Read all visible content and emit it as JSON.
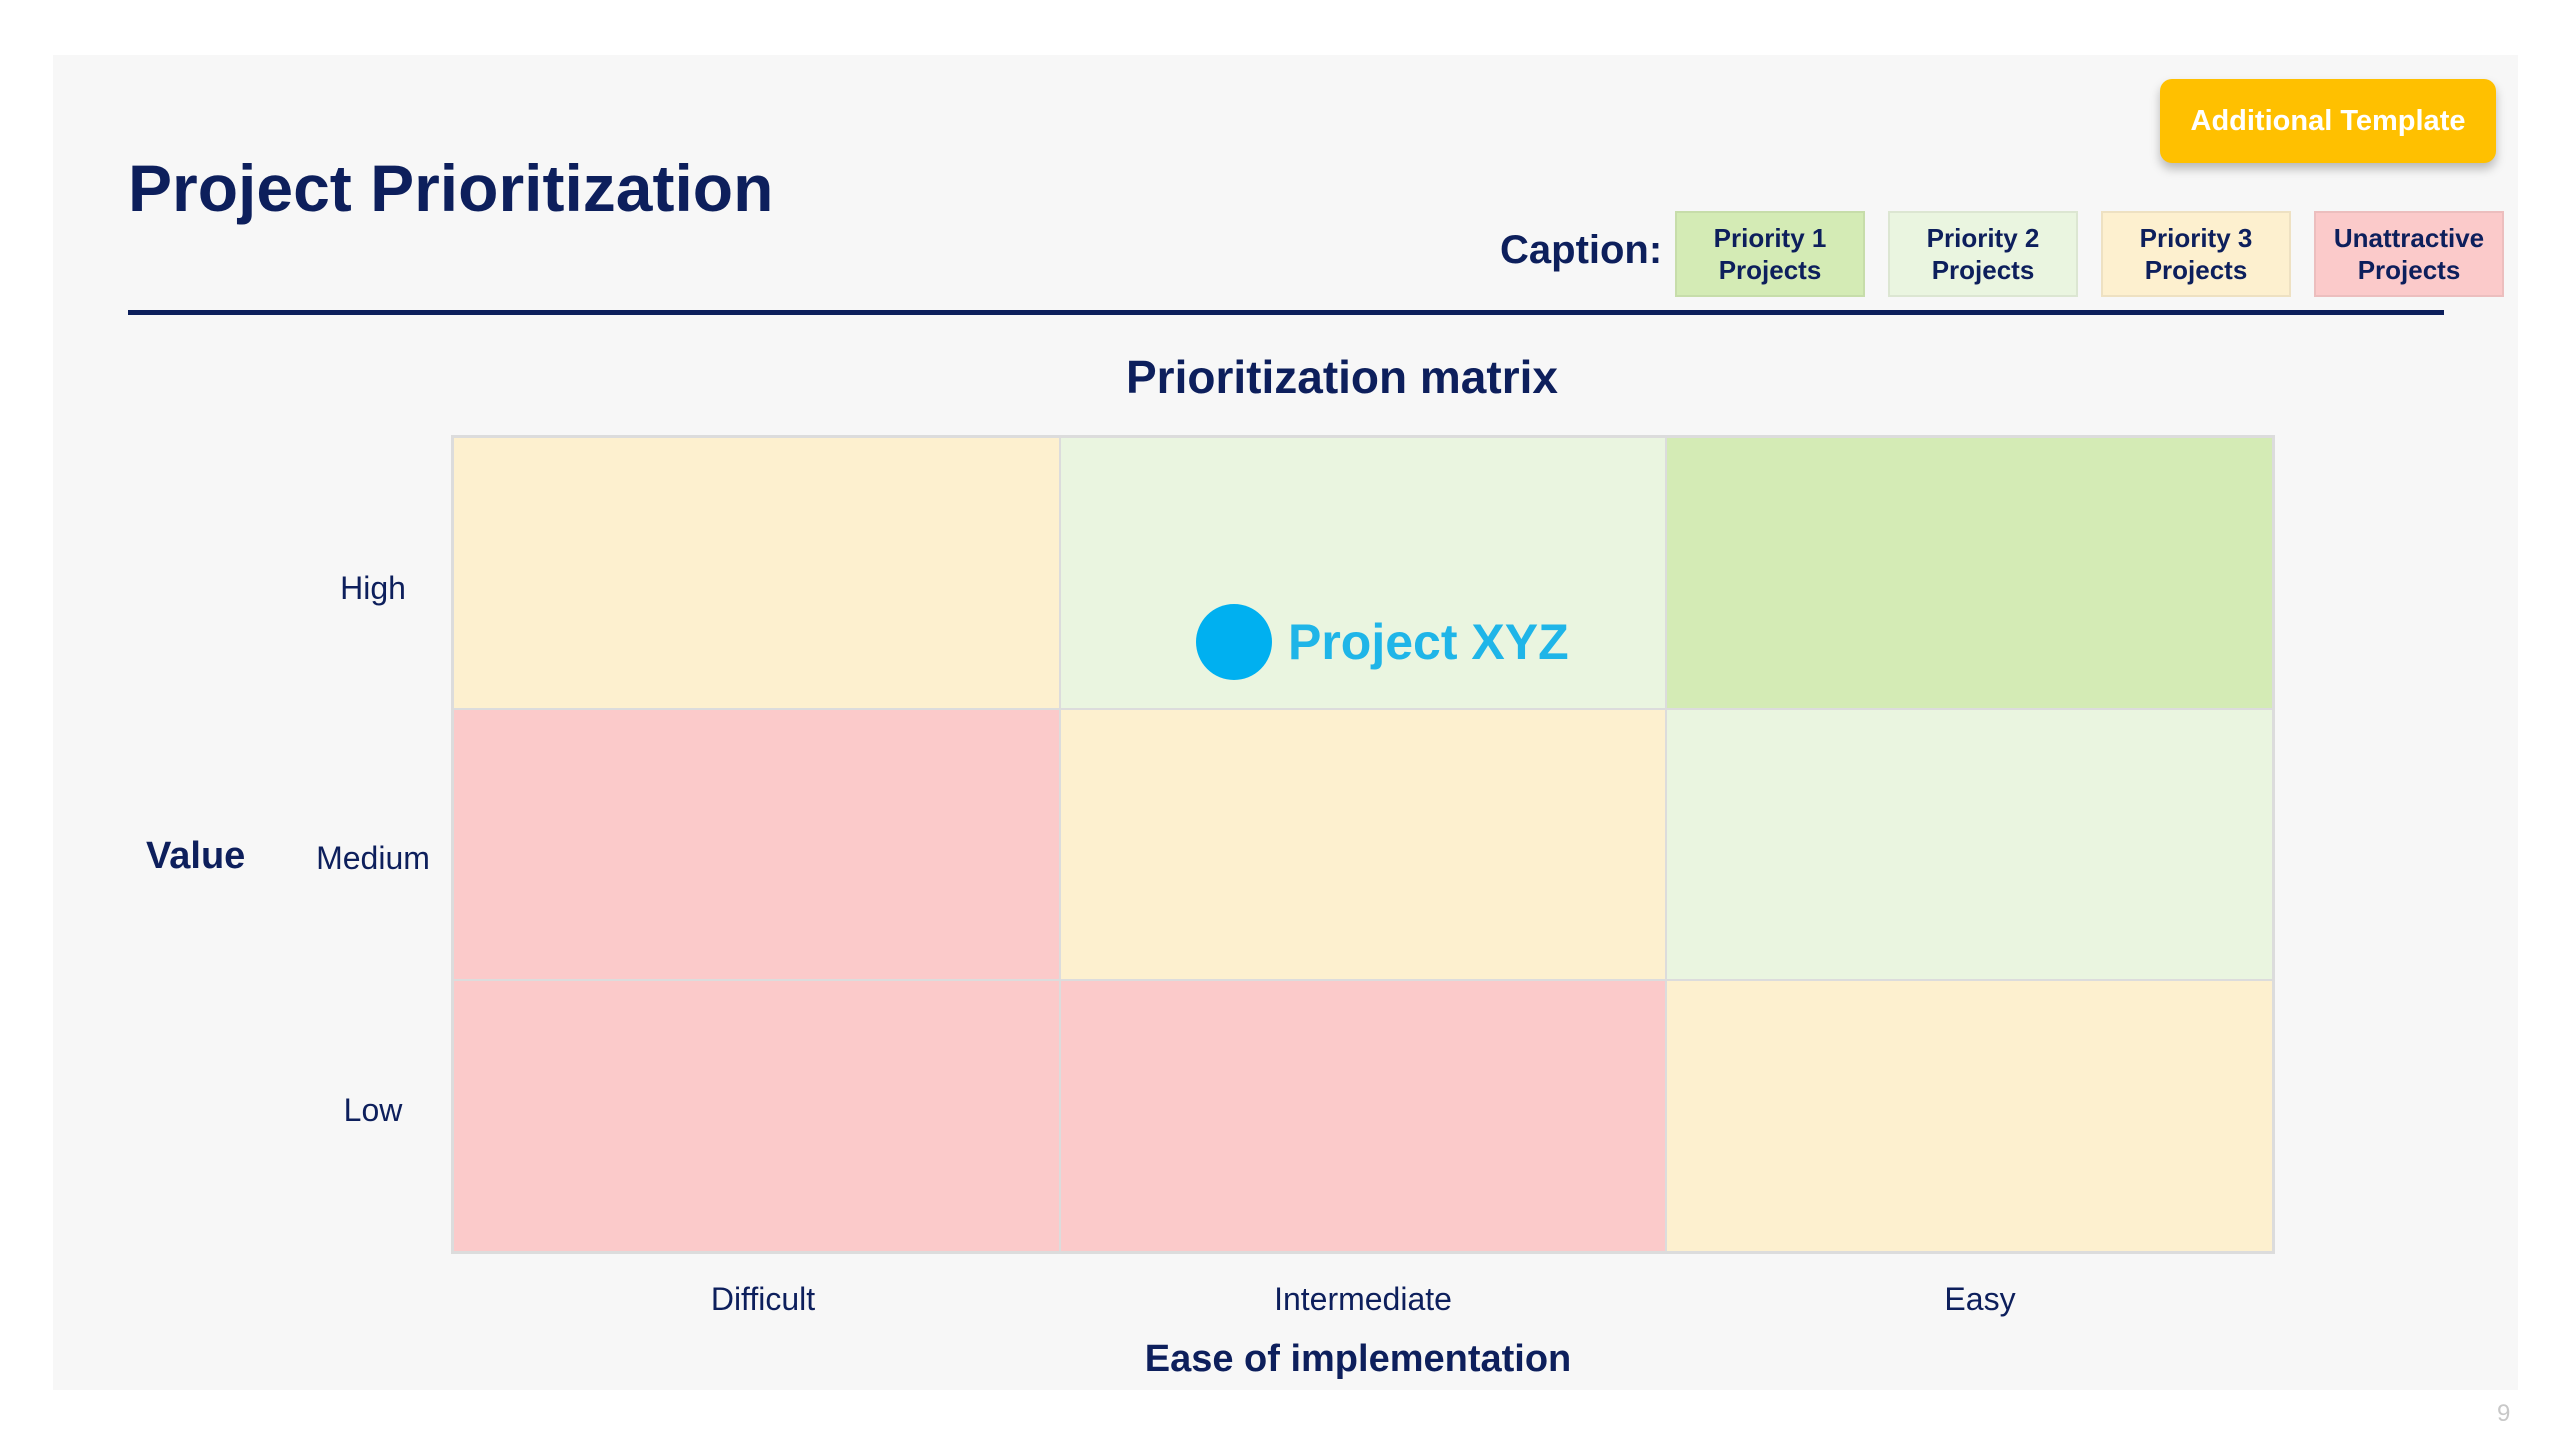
{
  "title": "Project Prioritization",
  "template_button": "Additional Template",
  "caption": {
    "label": "Caption:",
    "items": [
      {
        "label": "Priority 1 Projects",
        "color": "#d4ebb5"
      },
      {
        "label": "Priority 2 Projects",
        "color": "#eaf5e0"
      },
      {
        "label": "Priority 3 Projects",
        "color": "#fdf0cf"
      },
      {
        "label": "Unattractive Projects",
        "color": "#fbcaca"
      }
    ]
  },
  "matrix": {
    "title": "Prioritization matrix",
    "y_axis": "Value",
    "x_axis": "Ease of implementation",
    "rows": [
      "High",
      "Medium",
      "Low"
    ],
    "columns": [
      "Difficult",
      "Intermediate",
      "Easy"
    ],
    "cells": [
      [
        "#fdf0cf",
        "#eaf5e0",
        "#d4ebb5"
      ],
      [
        "#fbcaca",
        "#fdf0cf",
        "#eaf5e0"
      ],
      [
        "#fbcaca",
        "#fbcaca",
        "#fdf0cf"
      ]
    ]
  },
  "project": {
    "label": "Project XYZ",
    "row": "High",
    "column": "Intermediate",
    "color": "#00b0f0",
    "text_color": "#1fb5e8"
  },
  "page_number": "9"
}
